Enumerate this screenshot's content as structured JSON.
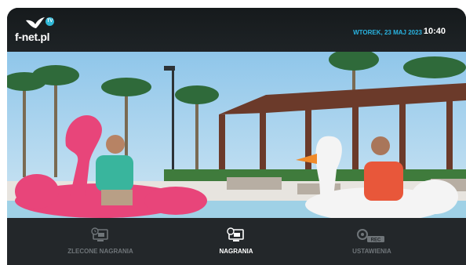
{
  "header": {
    "logo_text": "f-net.pl",
    "logo_badge": "TV",
    "date": "WTOREK, 23 MAJ 2023",
    "time": "10:40"
  },
  "nav": {
    "items": [
      {
        "label": "ZLECONE NAGRANIA",
        "icon": "scheduled-recordings-icon",
        "active": false
      },
      {
        "label": "NAGRANIA",
        "icon": "recordings-icon",
        "active": true
      },
      {
        "label": "USTAWIENIA",
        "icon": "settings-rec-icon",
        "active": false,
        "badge": "REC"
      }
    ]
  },
  "colors": {
    "accent": "#29b3e0",
    "header_bg": "#1a1e21",
    "bar_bg": "#23272a",
    "inactive_text": "#6f7579"
  }
}
